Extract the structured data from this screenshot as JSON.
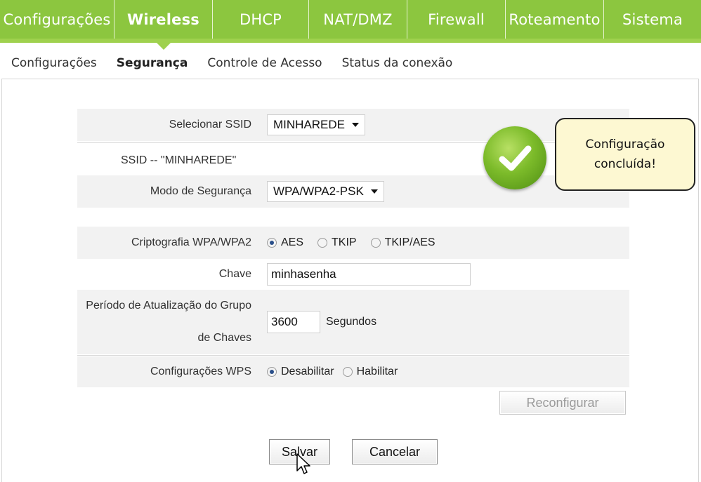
{
  "topnav": {
    "tabs": [
      {
        "label": "Configurações",
        "width": 163
      },
      {
        "label": "Wireless",
        "width": 140,
        "active": true
      },
      {
        "label": "DHCP",
        "width": 137
      },
      {
        "label": "NAT/DMZ",
        "width": 140
      },
      {
        "label": "Firewall",
        "width": 140
      },
      {
        "label": "Roteamento",
        "width": 140
      },
      {
        "label": "Sistema",
        "width": 138
      }
    ]
  },
  "subnav": {
    "items": [
      "Configurações",
      "Segurança",
      "Controle de Acesso",
      "Status da conexão"
    ],
    "active_index": 1
  },
  "form": {
    "ssid_select_label": "Selecionar SSID",
    "ssid_select_value": "MINHAREDE",
    "ssid_text": "SSID -- \"MINHAREDE\"",
    "security_mode_label": "Modo de Segurança",
    "security_mode_value": "WPA/WPA2-PSK",
    "crypto_label": "Criptografia WPA/WPA2",
    "crypto_options": [
      "AES",
      "TKIP",
      "TKIP/AES"
    ],
    "crypto_selected": "AES",
    "key_label": "Chave",
    "key_value": "minhasenha",
    "group_key_label_line1": "Período de Atualização do Grupo",
    "group_key_label_line2": "de Chaves",
    "group_key_value": "3600",
    "group_key_unit": "Segundos",
    "wps_label": "Configurações WPS",
    "wps_options": [
      "Desabilitar",
      "Habilitar"
    ],
    "wps_selected": "Desabilitar"
  },
  "buttons": {
    "reconfigure": "Reconfigurar",
    "save": "Salvar",
    "cancel": "Cancelar"
  },
  "balloon": {
    "line1": "Configuração",
    "line2": "concluída!"
  },
  "colors": {
    "nav_green": "#8cc63f",
    "balloon_bg": "#fdf8d2",
    "check_green": "#7cbb2a"
  }
}
